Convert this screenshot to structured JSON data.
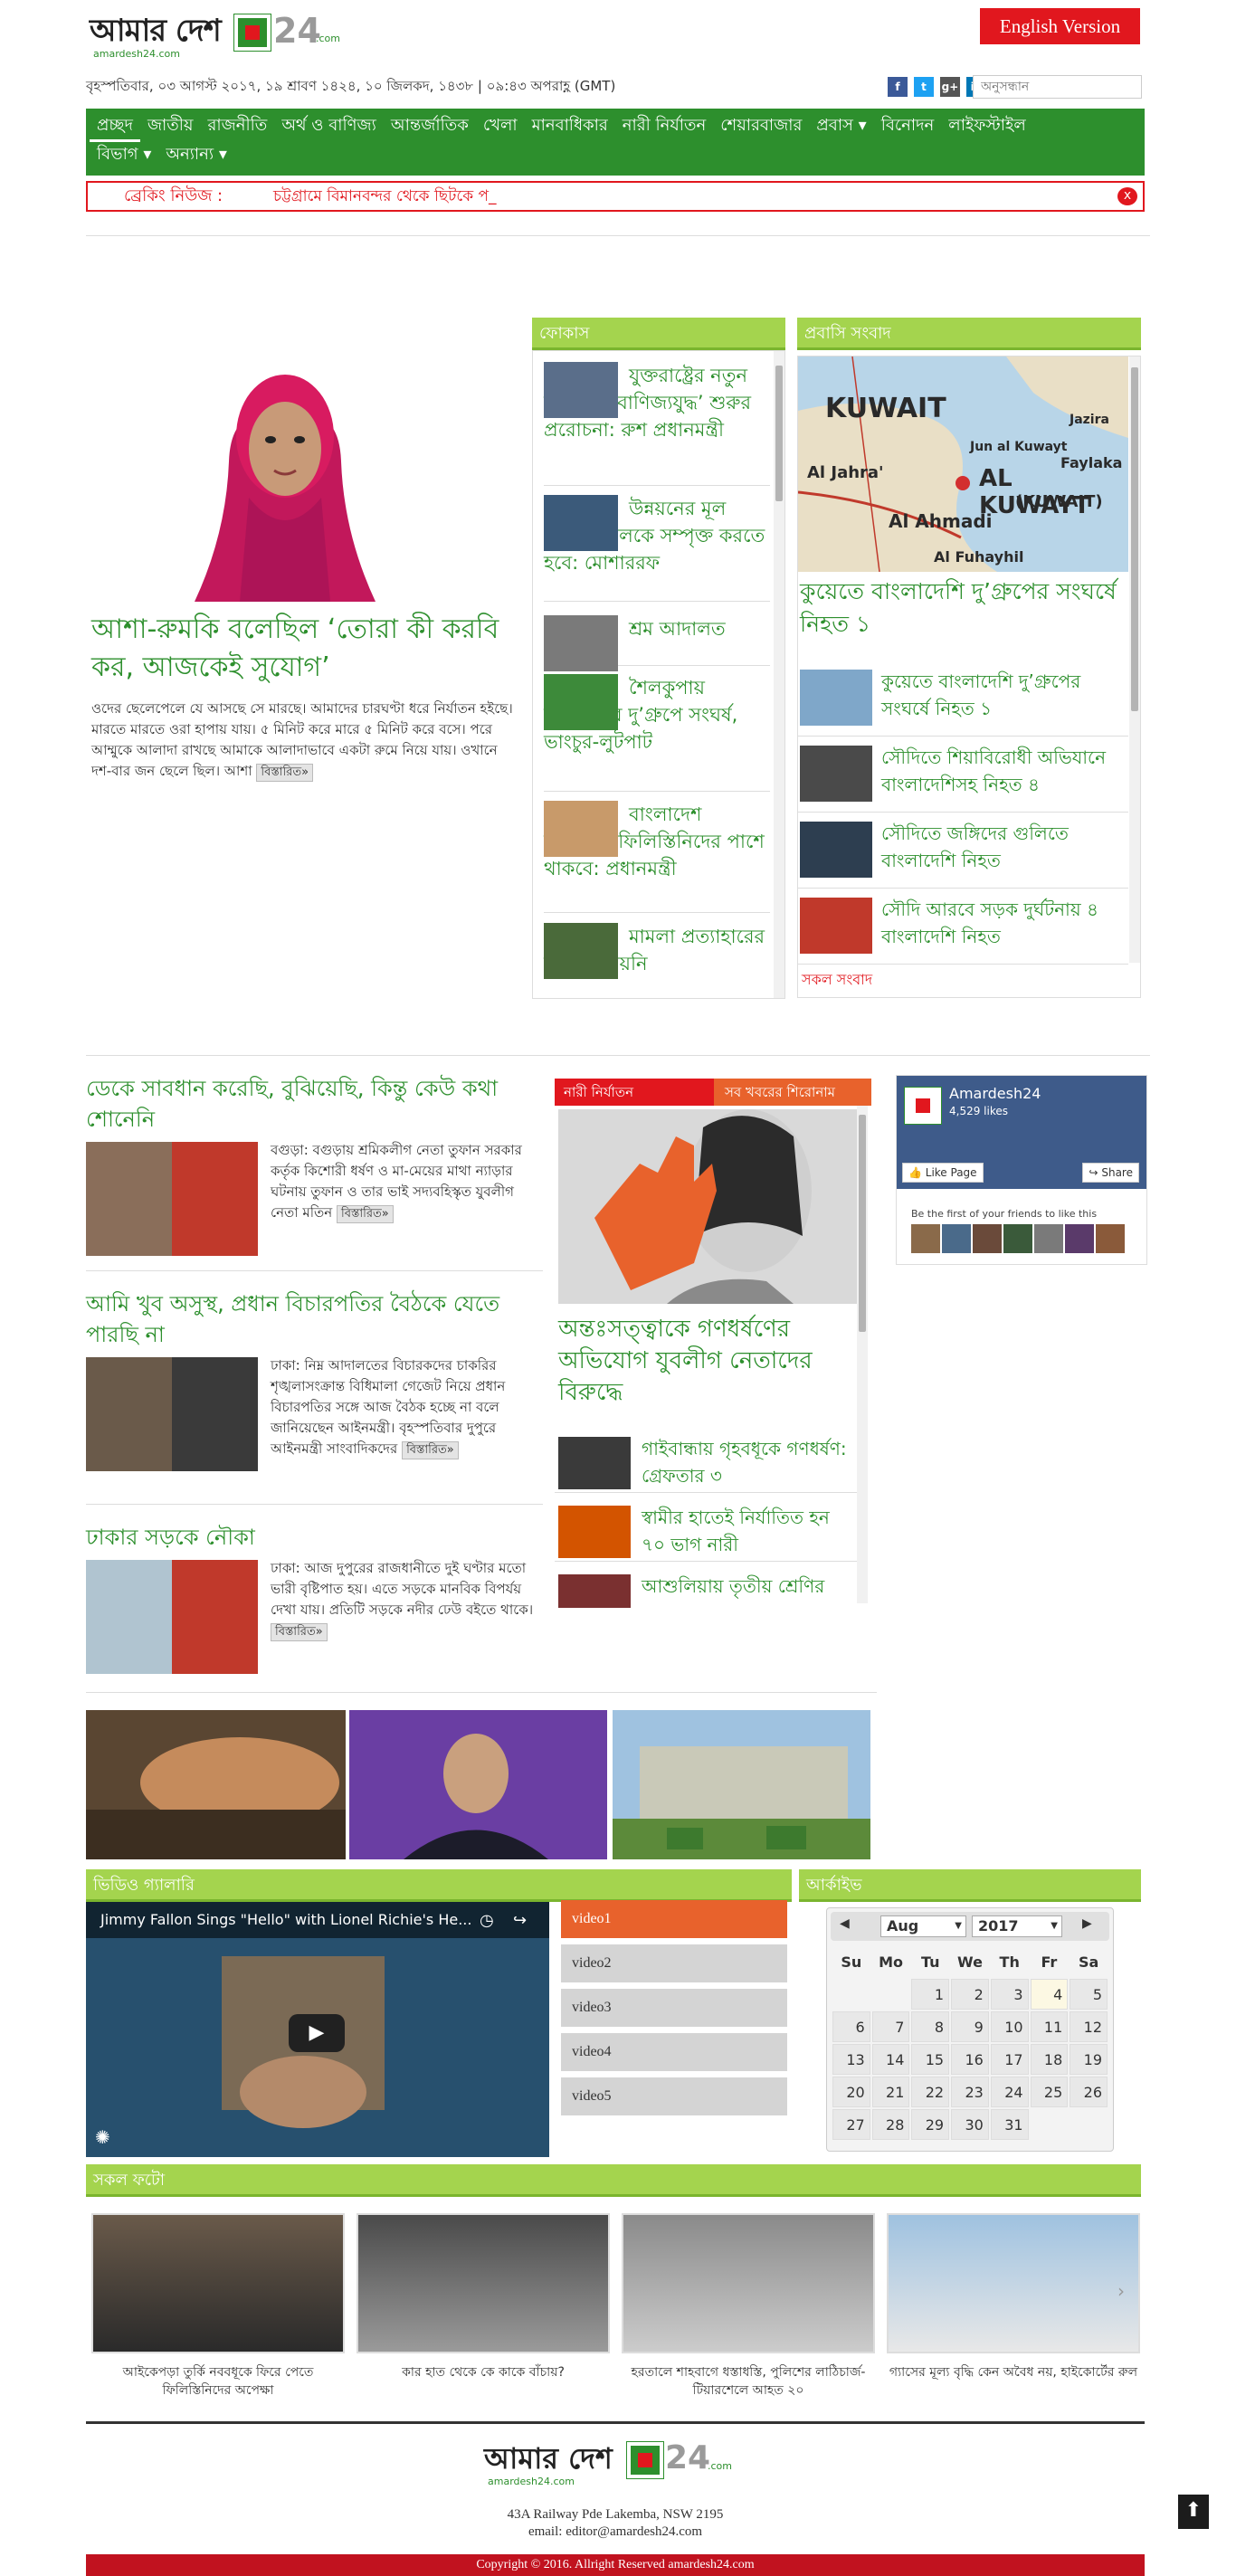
{
  "header": {
    "logo": {
      "text": "আমার দেশ",
      "num": "24",
      "com": ".com",
      "sub": "amardesh24.com"
    },
    "english_btn": "English Version"
  },
  "dateline": "বৃহস্পতিবার, ০৩ আগস্ট ২০১৭, ১৯ শ্রাবণ ১৪২৪, ১০ জিলকদ, ১৪৩৮ | ০৯:৪৩ অপরাহ্ণ (GMT)",
  "search": {
    "placeholder": "অনুসন্ধান"
  },
  "social": [
    {
      "name": "facebook",
      "label": "f",
      "color": "#3b5998"
    },
    {
      "name": "twitter",
      "label": "t",
      "color": "#1da1f2"
    },
    {
      "name": "googleplus",
      "label": "g+",
      "color": "#555555"
    },
    {
      "name": "linkedin",
      "label": "in",
      "color": "#0077b5"
    },
    {
      "name": "youtube",
      "label": "▶",
      "color": "#e52d27"
    },
    {
      "name": "rss",
      "label": "◉",
      "color": "#f26522"
    }
  ],
  "nav": {
    "row1": [
      "প্রচ্ছদ",
      "জাতীয়",
      "রাজনীতি",
      "অর্থ ও বাণিজ্য",
      "আন্তর্জাতিক",
      "খেলা",
      "মানবাধিকার",
      "নারী নির্যাতন",
      "শেয়ারবাজার",
      "প্রবাস ▾",
      "বিনোদন",
      "লাইফস্টাইল"
    ],
    "row2": [
      "বিভাগ ▾",
      "অন্যান্য ▾"
    ]
  },
  "breaking": {
    "label": "ব্রেকিং নিউজ :",
    "text": "চট্টগ্রামে বিমানবন্দর থেকে ছিটকে প_",
    "close": "x"
  },
  "lead": {
    "title": "আশা-রুমকি বলেছিল ‘তোরা কী করবি কর, আজকেই সুযোগ’",
    "body": "ওদের ছেলেপেলে যে আসছে সে মারছে। আমাদের চারঘণ্টা ধরে নির্যাতন হইছে। মারতে মারতে ওরা হাপায় যায়। ৫ মিনিট করে মারে ৫ মিনিট করে বসে। পরে আম্মুকে আলাদা রাখছে আমাকে আলাদাভাবে একটা রুমে নিয়ে যায়। ওখানে দশ-বার জন ছেলে ছিল। আশা",
    "more": "বিস্তারিত»"
  },
  "focus": {
    "header": "ফোকাস",
    "items": [
      "যুক্তরাষ্ট্রের নতুন অবরোধ ‘বাণিজ্যযুদ্ধ’ শুরুর প্ররোচনা: রুশ প্রধানমন্ত্রী",
      "উন্নয়নের মূল ধারায় সকলকে সম্পৃক্ত করতে হবে: মোশাররফ",
      "শ্রম আদালত",
      "শৈলকুপায় আ’লীগের দু’গ্রুপে সংঘর্ষ, ভাংচুর-লুটপাট",
      "বাংলাদেশ নিপীড়িত ফিলিস্তিনিদের পাশে থাকবে: প্রধানমন্ত্রী",
      "মামলা প্রত্যাহারের সিদ্ধান্ত নেয়নি"
    ]
  },
  "probashi": {
    "header": "প্রবাসি সংবাদ",
    "lead": "কুয়েতে বাংলাদেশি দু’গ্রুপের সংঘর্ষে নিহত ১",
    "map_labels": [
      "KUWAIT",
      "Jun al Kuwayt",
      "Jazira",
      "Al Jahra'",
      "AL KUWAYT",
      "Faylaka",
      "(KUWAIT)",
      "Al Ahmadi",
      "Al Fuhayhil"
    ],
    "items": [
      "কুয়েতে বাংলাদেশি দু’গ্রুপের সংঘর্ষে নিহত ১",
      "সৌদিতে শিয়াবিরোধী অভিযানে বাংলাদেশিসহ নিহত ৪",
      "সৌদিতে জঙ্গিদের গুলিতে বাংলাদেশি নিহত",
      "সৌদি আরবে সড়ক দুর্ঘটনায় ৪ বাংলাদেশি নিহত"
    ],
    "all": "সকল সংবাদ"
  },
  "stories": [
    {
      "title": "ডেকে সাবধান করেছি, বুঝিয়েছি, কিন্তু কেউ কথা শোনেনি",
      "body": "বগুড়া: বগুড়ায় শ্রমিকলীগ নেতা তুফান সরকার কর্তৃক কিশোরী ধর্ষণ ও মা-মেয়ের মাথা ন্যাড়ার ঘটনায় তুফান ও তার ভাই সদ্যবহিস্কৃত যুবলীগ নেতা মতিন",
      "more": "বিস্তারিত»"
    },
    {
      "title": "আমি খুব অসুস্থ, প্রধান বিচারপতির বৈঠকে যেতে পারছি না",
      "body": "ঢাকা: নিম্ন আদালতের বিচারকদের চাকরির শৃঙ্খলাসংক্রান্ত বিধিমালা গেজেট নিয়ে প্রধান বিচারপতির সঙ্গে আজ বৈঠক হচ্ছে না বলে জানিয়েছেন আইনমন্ত্রী। বৃহস্পতিবার দুপুরে আইনমন্ত্রী সাংবাদিকদের",
      "more": "বিস্তারিত»"
    },
    {
      "title": "ঢাকার সড়কে নৌকা",
      "body": "ঢাকা: আজ দুপুরের রাজধানীতে দুই ঘণ্টার মতো ভারী বৃষ্টিপাত হয়। এতে সড়কে মানবিক বিপর্যয় দেখা যায়। প্রতিটি সড়কে নদীর ঢেউ বইতে থাকে।",
      "more": "বিস্তারিত»"
    }
  ],
  "nari": {
    "tab1": "নারী নির্যাতন",
    "tab2": "সব খবরের শিরোনাম",
    "lead": "অন্তঃসত্ত্বাকে গণধর্ষণের অভিযোগ যুবলীগ নেতাদের বিরুদ্ধে",
    "items": [
      "গাইবান্ধায় গৃহবধূকে গণধর্ষণ: গ্রেফতার ৩",
      "স্বামীর হাতেই নির্যাতিত হন ৭০ ভাগ নারী",
      "আশুলিয়ায় তৃতীয় শ্রেণির"
    ]
  },
  "fb": {
    "name": "Amardesh24",
    "likes": "4,529 likes",
    "like_btn": "Like Page",
    "share_btn": "Share",
    "friends": "Be the first of your friends to like this"
  },
  "video": {
    "header": "ভিডিও গ্যালারি",
    "title": "Jimmy Fallon Sings \"Hello\" with Lionel Richie's He...",
    "items": [
      "video1",
      "video2",
      "video3",
      "video4",
      "video5"
    ]
  },
  "archive": {
    "header": "আর্কাইভ",
    "month": "Aug",
    "year": "2017",
    "days": [
      "Su",
      "Mo",
      "Tu",
      "We",
      "Th",
      "Fr",
      "Sa"
    ],
    "weeks": [
      [
        "",
        "",
        "1",
        "2",
        "3",
        "4",
        "5"
      ],
      [
        "6",
        "7",
        "8",
        "9",
        "10",
        "11",
        "12"
      ],
      [
        "13",
        "14",
        "15",
        "16",
        "17",
        "18",
        "19"
      ],
      [
        "20",
        "21",
        "22",
        "23",
        "24",
        "25",
        "26"
      ],
      [
        "27",
        "28",
        "29",
        "30",
        "31",
        "",
        ""
      ]
    ],
    "today": "4"
  },
  "photos": {
    "header": "সকল ফটো",
    "items": [
      "আইকেপড়া তুর্কি নববধূকে ফিরে পেতে ফিলিস্তিনিদের অপেক্ষা",
      "কার হাত থেকে কে কাকে বাঁচায়?",
      "হরতালে শাহবাগে ধস্তাধস্তি, পুলিশের লাঠিচার্জ-টিয়ারশেলে আহত ২০",
      "গ্যাসের মূল্য বৃদ্ধি কেন অবৈধ নয়, হাইকোর্টের রুল"
    ]
  },
  "footer": {
    "address": "43A Railway Pde Lakemba, NSW 2195",
    "email": "email: editor@amardesh24.com",
    "copyright": "Copyright © 2016. Allright Reserved amardesh24.com"
  },
  "colors": {
    "green": "#2d8f2d",
    "lightgreen": "#a4d44e",
    "red": "#e1171e",
    "orange": "#e8622c"
  }
}
